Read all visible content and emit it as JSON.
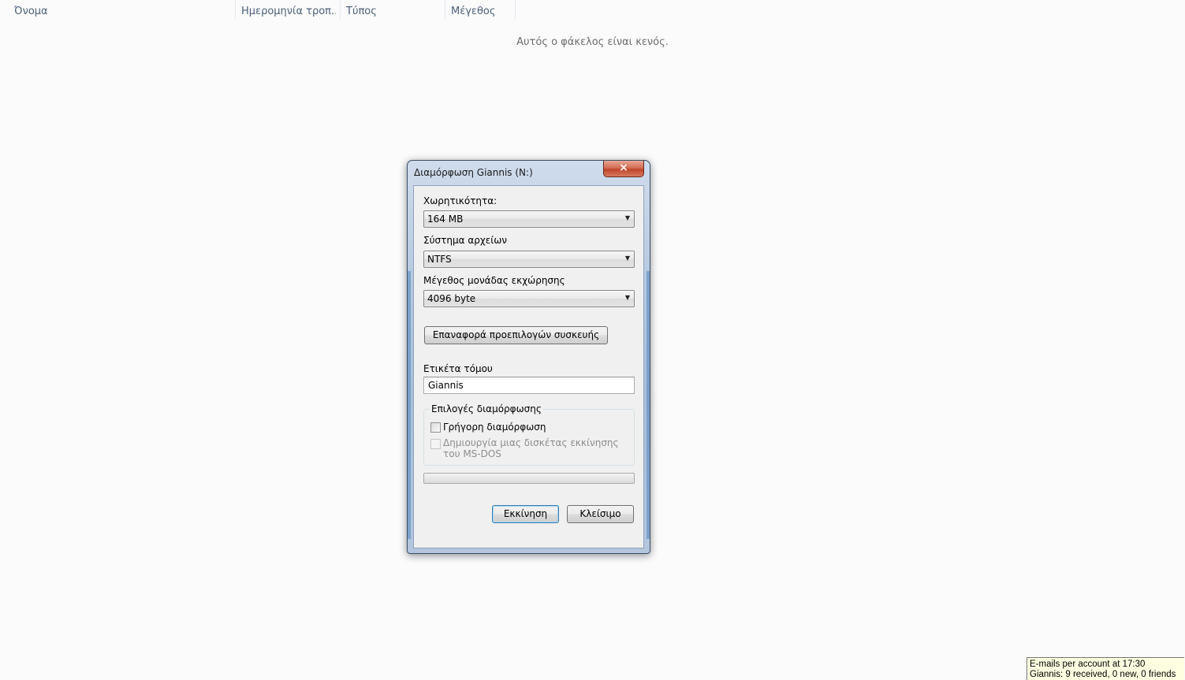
{
  "explorer": {
    "columns": [
      {
        "label": "Όνομα"
      },
      {
        "label": "Ημερομηνία τροπ..."
      },
      {
        "label": "Τύπος"
      },
      {
        "label": "Μέγεθος"
      }
    ],
    "empty_message": "Αυτός ο φάκελος είναι κενός."
  },
  "dialog": {
    "title": "Διαμόρφωση Giannis (N:)",
    "close_icon": "×",
    "capacity": {
      "label": "Χωρητικότητα:",
      "value": "164 MB"
    },
    "filesystem": {
      "label": "Σύστημα αρχείων",
      "value": "NTFS"
    },
    "allocation": {
      "label": "Μέγεθος μονάδας εκχώρησης",
      "value": "4096 byte"
    },
    "restore_defaults": "Επαναφορά προεπιλογών συσκευής",
    "volume_label": {
      "label": "Ετικέτα τόμου",
      "value": "Giannis"
    },
    "options": {
      "title": "Επιλογές διαμόρφωσης",
      "quick_format": {
        "label": "Γρήγορη διαμόρφωση",
        "checked": false
      },
      "msdos": {
        "label": "Δημιουργία μιας δισκέτας εκκίνησης του MS-DOS",
        "checked": false,
        "enabled": false
      }
    },
    "progress": 0,
    "start": "Εκκίνηση",
    "close": "Κλείσιμο"
  },
  "tray_tooltip": {
    "line1": "E-mails per account at 17:30",
    "line2": "Giannis: 9 received, 0 new, 0 friends"
  }
}
